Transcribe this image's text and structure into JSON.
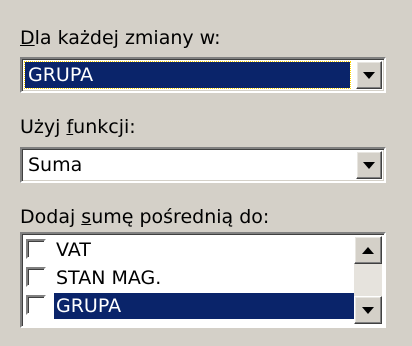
{
  "fields": {
    "for_each_change": {
      "label_prefix": "",
      "label_accel": "D",
      "label_rest": "la każdej zmiany w:",
      "value": "GRUPA"
    },
    "use_function": {
      "label_prefix": "Użyj ",
      "label_accel": "f",
      "label_rest": "unkcji:",
      "value": "Suma"
    },
    "add_subtotal": {
      "label_prefix": "Dodaj ",
      "label_accel": "s",
      "label_rest": "umę pośrednią do:",
      "items": [
        {
          "label": "VAT",
          "checked": false,
          "selected": false
        },
        {
          "label": "STAN MAG.",
          "checked": false,
          "selected": false
        },
        {
          "label": "GRUPA",
          "checked": false,
          "selected": true
        }
      ]
    }
  },
  "icons": {
    "dropdown_arrow": "chevron-down-icon",
    "scroll_up": "scroll-up-arrow-icon",
    "scroll_down": "scroll-down-arrow-icon"
  },
  "colors": {
    "background": "#d4d0c8",
    "selection": "#0a246a",
    "selection_text": "#ffffff"
  }
}
